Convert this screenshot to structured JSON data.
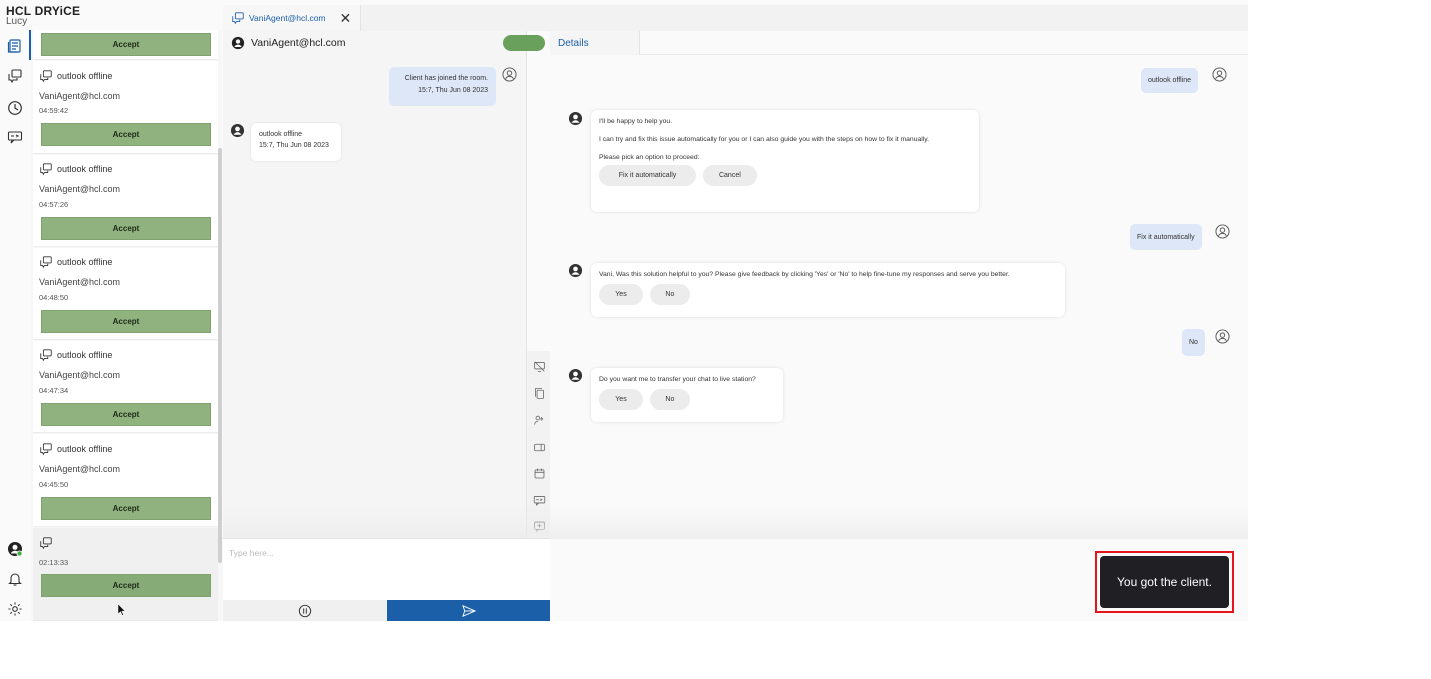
{
  "brand": {
    "name": "HCL DRYiCE",
    "user": "Lucy"
  },
  "rail": {
    "top_icons": [
      "document-list-icon",
      "chat-bubbles-icon",
      "clock-icon",
      "chat-transfer-icon"
    ],
    "bottom_icons": [
      "agent-avatar-icon",
      "bell-icon",
      "gear-icon"
    ]
  },
  "queue": {
    "top_accept": "Accept",
    "items": [
      {
        "topic": "outlook offline",
        "email": "VaniAgent@hcl.com",
        "time": "04:59:42",
        "accept": "Accept"
      },
      {
        "topic": "outlook offline",
        "email": "VaniAgent@hcl.com",
        "time": "04:57:26",
        "accept": "Accept"
      },
      {
        "topic": "outlook offline",
        "email": "VaniAgent@hcl.com",
        "time": "04:48:50",
        "accept": "Accept"
      },
      {
        "topic": "outlook offline",
        "email": "VaniAgent@hcl.com",
        "time": "04:47:34",
        "accept": "Accept"
      },
      {
        "topic": "outlook offline",
        "email": "VaniAgent@hcl.com",
        "time": "04:45:50",
        "accept": "Accept"
      },
      {
        "topic": "",
        "email": "",
        "time": "02:13:33",
        "accept": "Accept"
      }
    ]
  },
  "tab": {
    "label": "VaniAgent@hcl.com",
    "close": "✕"
  },
  "chat": {
    "header": "VaniAgent@hcl.com",
    "status_color": "#69a05c",
    "system_msg": {
      "line1": "Client has joined the room.",
      "line2": "15:7, Thu Jun 08 2023"
    },
    "client_msg": {
      "line1": "outlook offline",
      "line2": "15:7, Thu Jun 08 2023"
    },
    "input_placeholder": "Type here..."
  },
  "details": {
    "tab_label": "Details",
    "user_msg1": "outlook offline",
    "bot_msg1": {
      "line1": "I'll be happy to help you.",
      "line2": "I can try and fix this issue automatically for you or I can also guide you with the steps on how to fix it manually.",
      "line3": "Please pick an option to proceed:",
      "btn1": "Fix it automatically",
      "btn2": "Cancel"
    },
    "user_msg2": "Fix it automatically",
    "bot_msg2": {
      "text": "Vani, Was this solution helpful to you? Please give feedback by clicking 'Yes' or 'No' to help fine-tune my responses and serve you better.",
      "btn1": "Yes",
      "btn2": "No"
    },
    "user_msg3": "No",
    "bot_msg3": {
      "text": "Do you want me to transfer your chat to live station?",
      "btn1": "Yes",
      "btn2": "No"
    }
  },
  "toast": {
    "text": "You got the client.",
    "highlight_color": "#e8141b"
  },
  "colors": {
    "accent": "#1b5fa8",
    "accept": "#8fb27f",
    "user_bubble": "#dde7f7"
  }
}
